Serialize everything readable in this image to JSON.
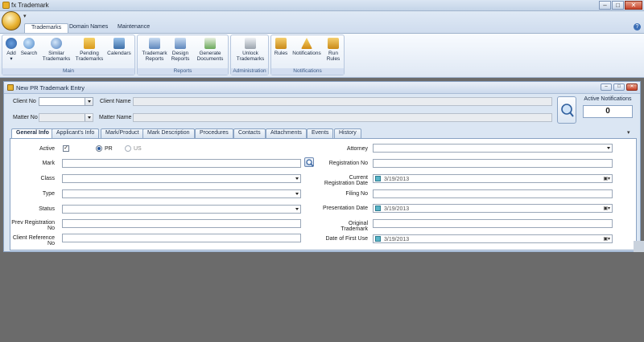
{
  "window": {
    "title": "fx Trademark",
    "minimize": "–",
    "maximize": "□",
    "close": "✕"
  },
  "ribbon": {
    "qat_arrow": "▾",
    "help": "?",
    "tabs": [
      "Trademarks",
      "Domain Names",
      "Maintenance"
    ],
    "groups": {
      "main": {
        "label": "Main",
        "buttons": [
          "Add",
          "Search",
          "Similar Trademarks",
          "Pending Trademarks",
          "Calendars"
        ]
      },
      "reports": {
        "label": "Reports",
        "buttons": [
          "Trademark Reports",
          "Design Reports",
          "Generate Documents"
        ]
      },
      "administration": {
        "label": "Administration",
        "buttons": [
          "Unlock Trademarks"
        ]
      },
      "notifications": {
        "label": "Notifications",
        "buttons": [
          "Rules",
          "Notifications",
          "Run Rules"
        ]
      }
    }
  },
  "entry": {
    "title": "New PR Trademark Entry",
    "client_no_label": "Client No",
    "client_name_label": "Client Name",
    "matter_no_label": "Matter No",
    "matter_name_label": "Matter Name",
    "notifications_label": "Active Notifications",
    "notifications_count": "0",
    "tabs": [
      "General Info",
      "Applicant's Info",
      "Mark/Product",
      "Mark Description",
      "Procedures",
      "Contacts",
      "Attachments",
      "Events",
      "History"
    ],
    "tabs_arrow": "▾"
  },
  "general": {
    "active_label": "Active",
    "active_checked": "✓",
    "radio_pr": "PR",
    "radio_us": "US",
    "mark_label": "Mark",
    "class_label": "Class",
    "type_label": "Type",
    "status_label": "Status",
    "prev_reg_label": "Prev Registration No",
    "client_ref_label": "Client Reference No",
    "attorney_label": "Attorney",
    "registration_no_label": "Registration No",
    "current_reg_date_label": "Current Registration Date",
    "current_reg_date_value": "3/19/2013",
    "filing_no_label": "Filing No",
    "presentation_date_label": "Presentation Date",
    "presentation_date_value": "3/19/2013",
    "original_trademark_label": "Original Trademark",
    "date_first_use_label": "Date of First Use",
    "date_first_use_value": "3/19/2013"
  }
}
